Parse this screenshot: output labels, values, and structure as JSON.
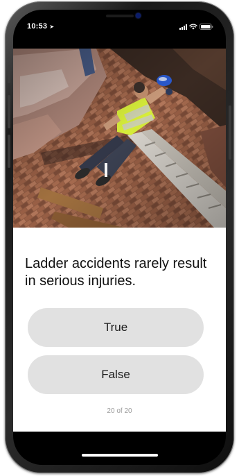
{
  "status_bar": {
    "time": "10:53",
    "location_icon": "location-arrow-icon",
    "icons": [
      "signal-icon",
      "wifi-icon",
      "battery-icon"
    ]
  },
  "photo": {
    "icon": "ladder-accident-photo"
  },
  "quiz": {
    "question": "Ladder accidents rarely result in serious injuries.",
    "answers": [
      {
        "label": "True"
      },
      {
        "label": "False"
      }
    ],
    "progress": {
      "text": "20 of 20",
      "current": 20,
      "total": 20
    }
  },
  "colors": {
    "button_bg": "#e1e1e1",
    "progress_text": "#9a9a9a",
    "screen_bg": "#000000",
    "card_bg": "#ffffff"
  }
}
